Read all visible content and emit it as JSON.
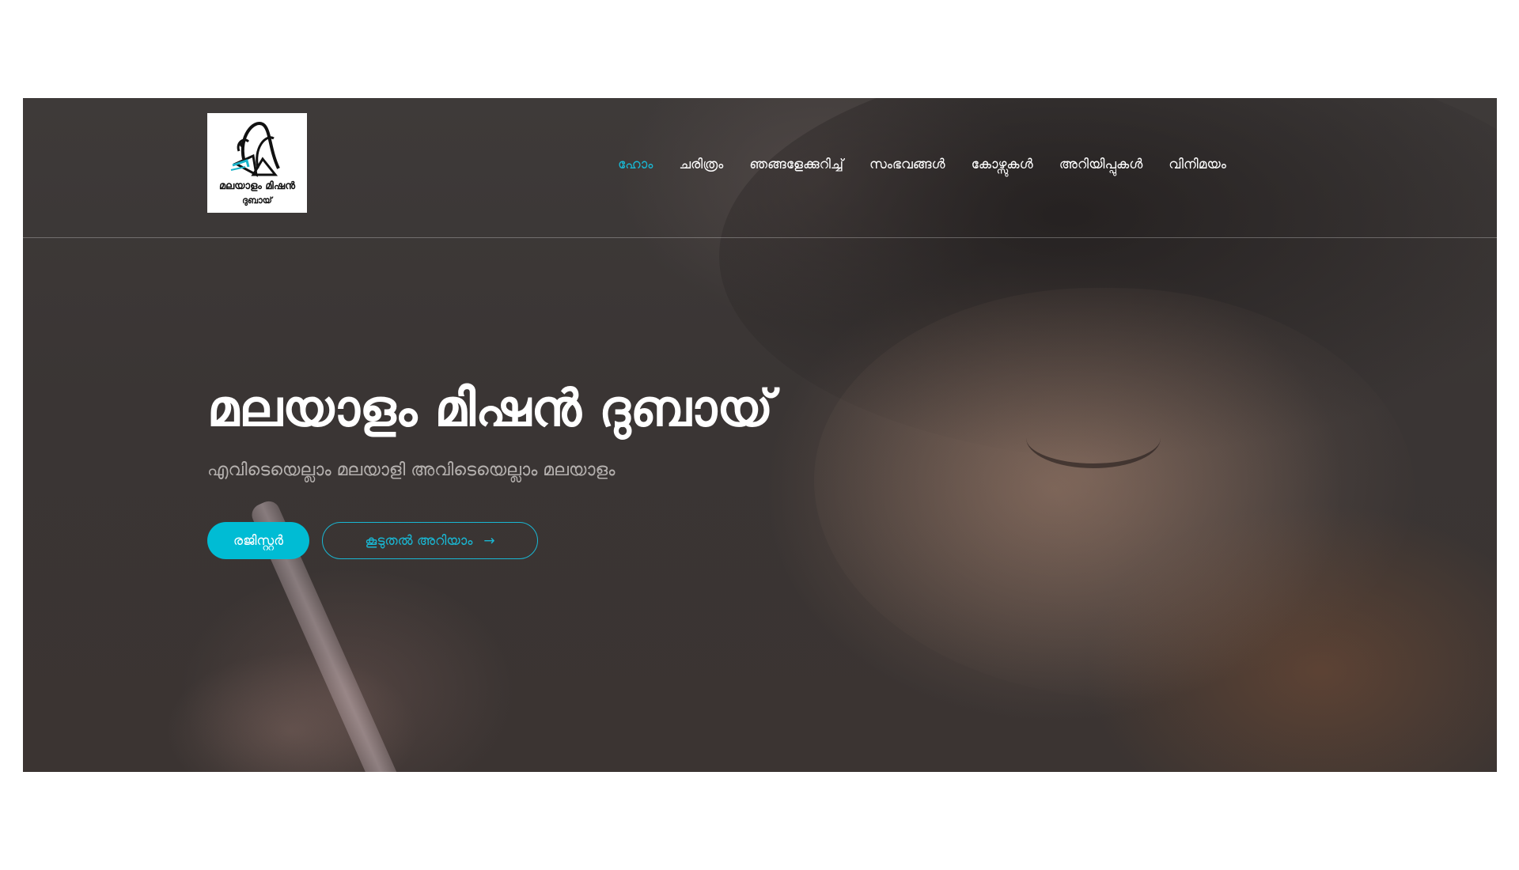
{
  "logo": {
    "line1": "മലയാളം മിഷൻ",
    "line2": "ദുബായ്"
  },
  "nav": {
    "items": [
      {
        "label": "ഹോം",
        "active": true
      },
      {
        "label": "ചരിത്രം",
        "active": false
      },
      {
        "label": "ഞങ്ങളേക്കുറിച്ച്",
        "active": false
      },
      {
        "label": "സംഭവങ്ങൾ",
        "active": false
      },
      {
        "label": "കോഴ്സുകൾ",
        "active": false
      },
      {
        "label": "അറിയിപ്പുകൾ",
        "active": false
      },
      {
        "label": "വിനിമയം",
        "active": false
      }
    ]
  },
  "hero": {
    "title": "മലയാളം മിഷൻ ദുബായ്",
    "subtitle": "എവിടെയെല്ലാം മലയാളി അവിടെയെല്ലാം മലയാളം",
    "primary_button": "രജിസ്റ്റർ",
    "secondary_button": "കൂടുതൽ അറിയാം",
    "secondary_icon": "arrow-right-icon"
  },
  "colors": {
    "accent": "#00bcd4",
    "accent_text": "#19b7d3",
    "hero_text": "#ffffff",
    "subtitle_text": "#b4b0ae"
  }
}
